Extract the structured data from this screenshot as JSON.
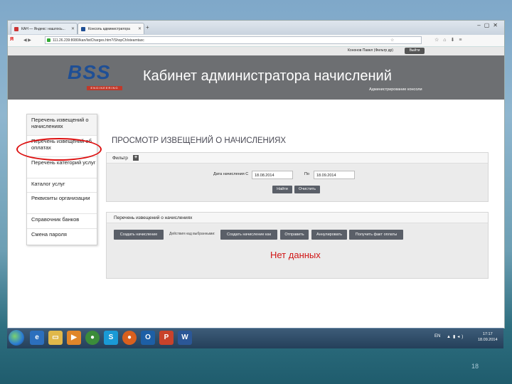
{
  "tabs": [
    {
      "label": "КАН — Яндекс: нашлось..."
    },
    {
      "label": "Консоль администратора"
    }
  ],
  "address": {
    "logo": "Я",
    "url": "111.26.239:8080/kan/listCharges.htm?/ShopCh/steamtaxc"
  },
  "userbar": {
    "user": "Кононов Павел (Фильтр др)",
    "logout": "Выйти"
  },
  "header": {
    "logo_text": "BSS",
    "logo_sub": "ENGINEERING",
    "title": "Кабинет администратора начислений",
    "subtitle": "Администрирование консоли"
  },
  "sidebar": {
    "items": [
      {
        "label": "Перечень извещений о начислениях"
      },
      {
        "label": "Перечень извещений об оплатах"
      },
      {
        "label": "Перечень категорий услуг"
      },
      {
        "label": "Каталог услуг"
      },
      {
        "label": "Реквизиты организации"
      },
      {
        "label": "Справочник банков"
      },
      {
        "label": "Смена пароля"
      }
    ]
  },
  "main": {
    "title": "ПРОСМОТР ИЗВЕЩЕНИЙ О НАЧИСЛЕНИЯХ",
    "filter": {
      "label": "Фильтр",
      "plus": "+",
      "date_from_label": "Дата начисления С",
      "date_from": "18.08.2014",
      "date_to_label": "По",
      "date_to": "18.09.2014",
      "find": "Найти",
      "clear": "Очистить"
    },
    "list": {
      "label": "Перечень извещений о начислениях",
      "create": "Создать начисление",
      "actions_label": "Действия над выбранными:",
      "create_as": "Создать начисление как",
      "send": "Отправить",
      "annul": "Аннулировать",
      "get_fact": "Получить факт оплаты",
      "empty": "Нет данных"
    }
  },
  "taskbar": {
    "lang": "EN",
    "time": "17:17",
    "date": "18.09.2014"
  },
  "slide_number": "18"
}
